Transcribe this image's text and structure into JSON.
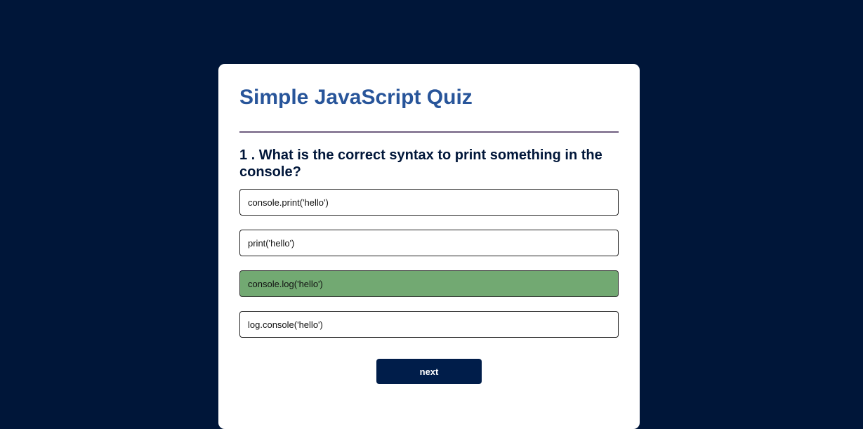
{
  "quiz": {
    "title": "Simple JavaScript Quiz",
    "question": "1 . What is the correct syntax to print something in the console?",
    "answers": [
      {
        "label": "console.print('hello')",
        "state": "default"
      },
      {
        "label": "print('hello')",
        "state": "default"
      },
      {
        "label": "console.log('hello')",
        "state": "correct"
      },
      {
        "label": "log.console('hello')",
        "state": "default"
      }
    ],
    "next_label": "next"
  },
  "colors": {
    "page_background": "#001639",
    "card_background": "#ffffff",
    "title": "#28559a",
    "question": "#001639",
    "divider": "#6e5d7f",
    "correct_answer": "#72a972",
    "next_button": "#001d4a"
  }
}
